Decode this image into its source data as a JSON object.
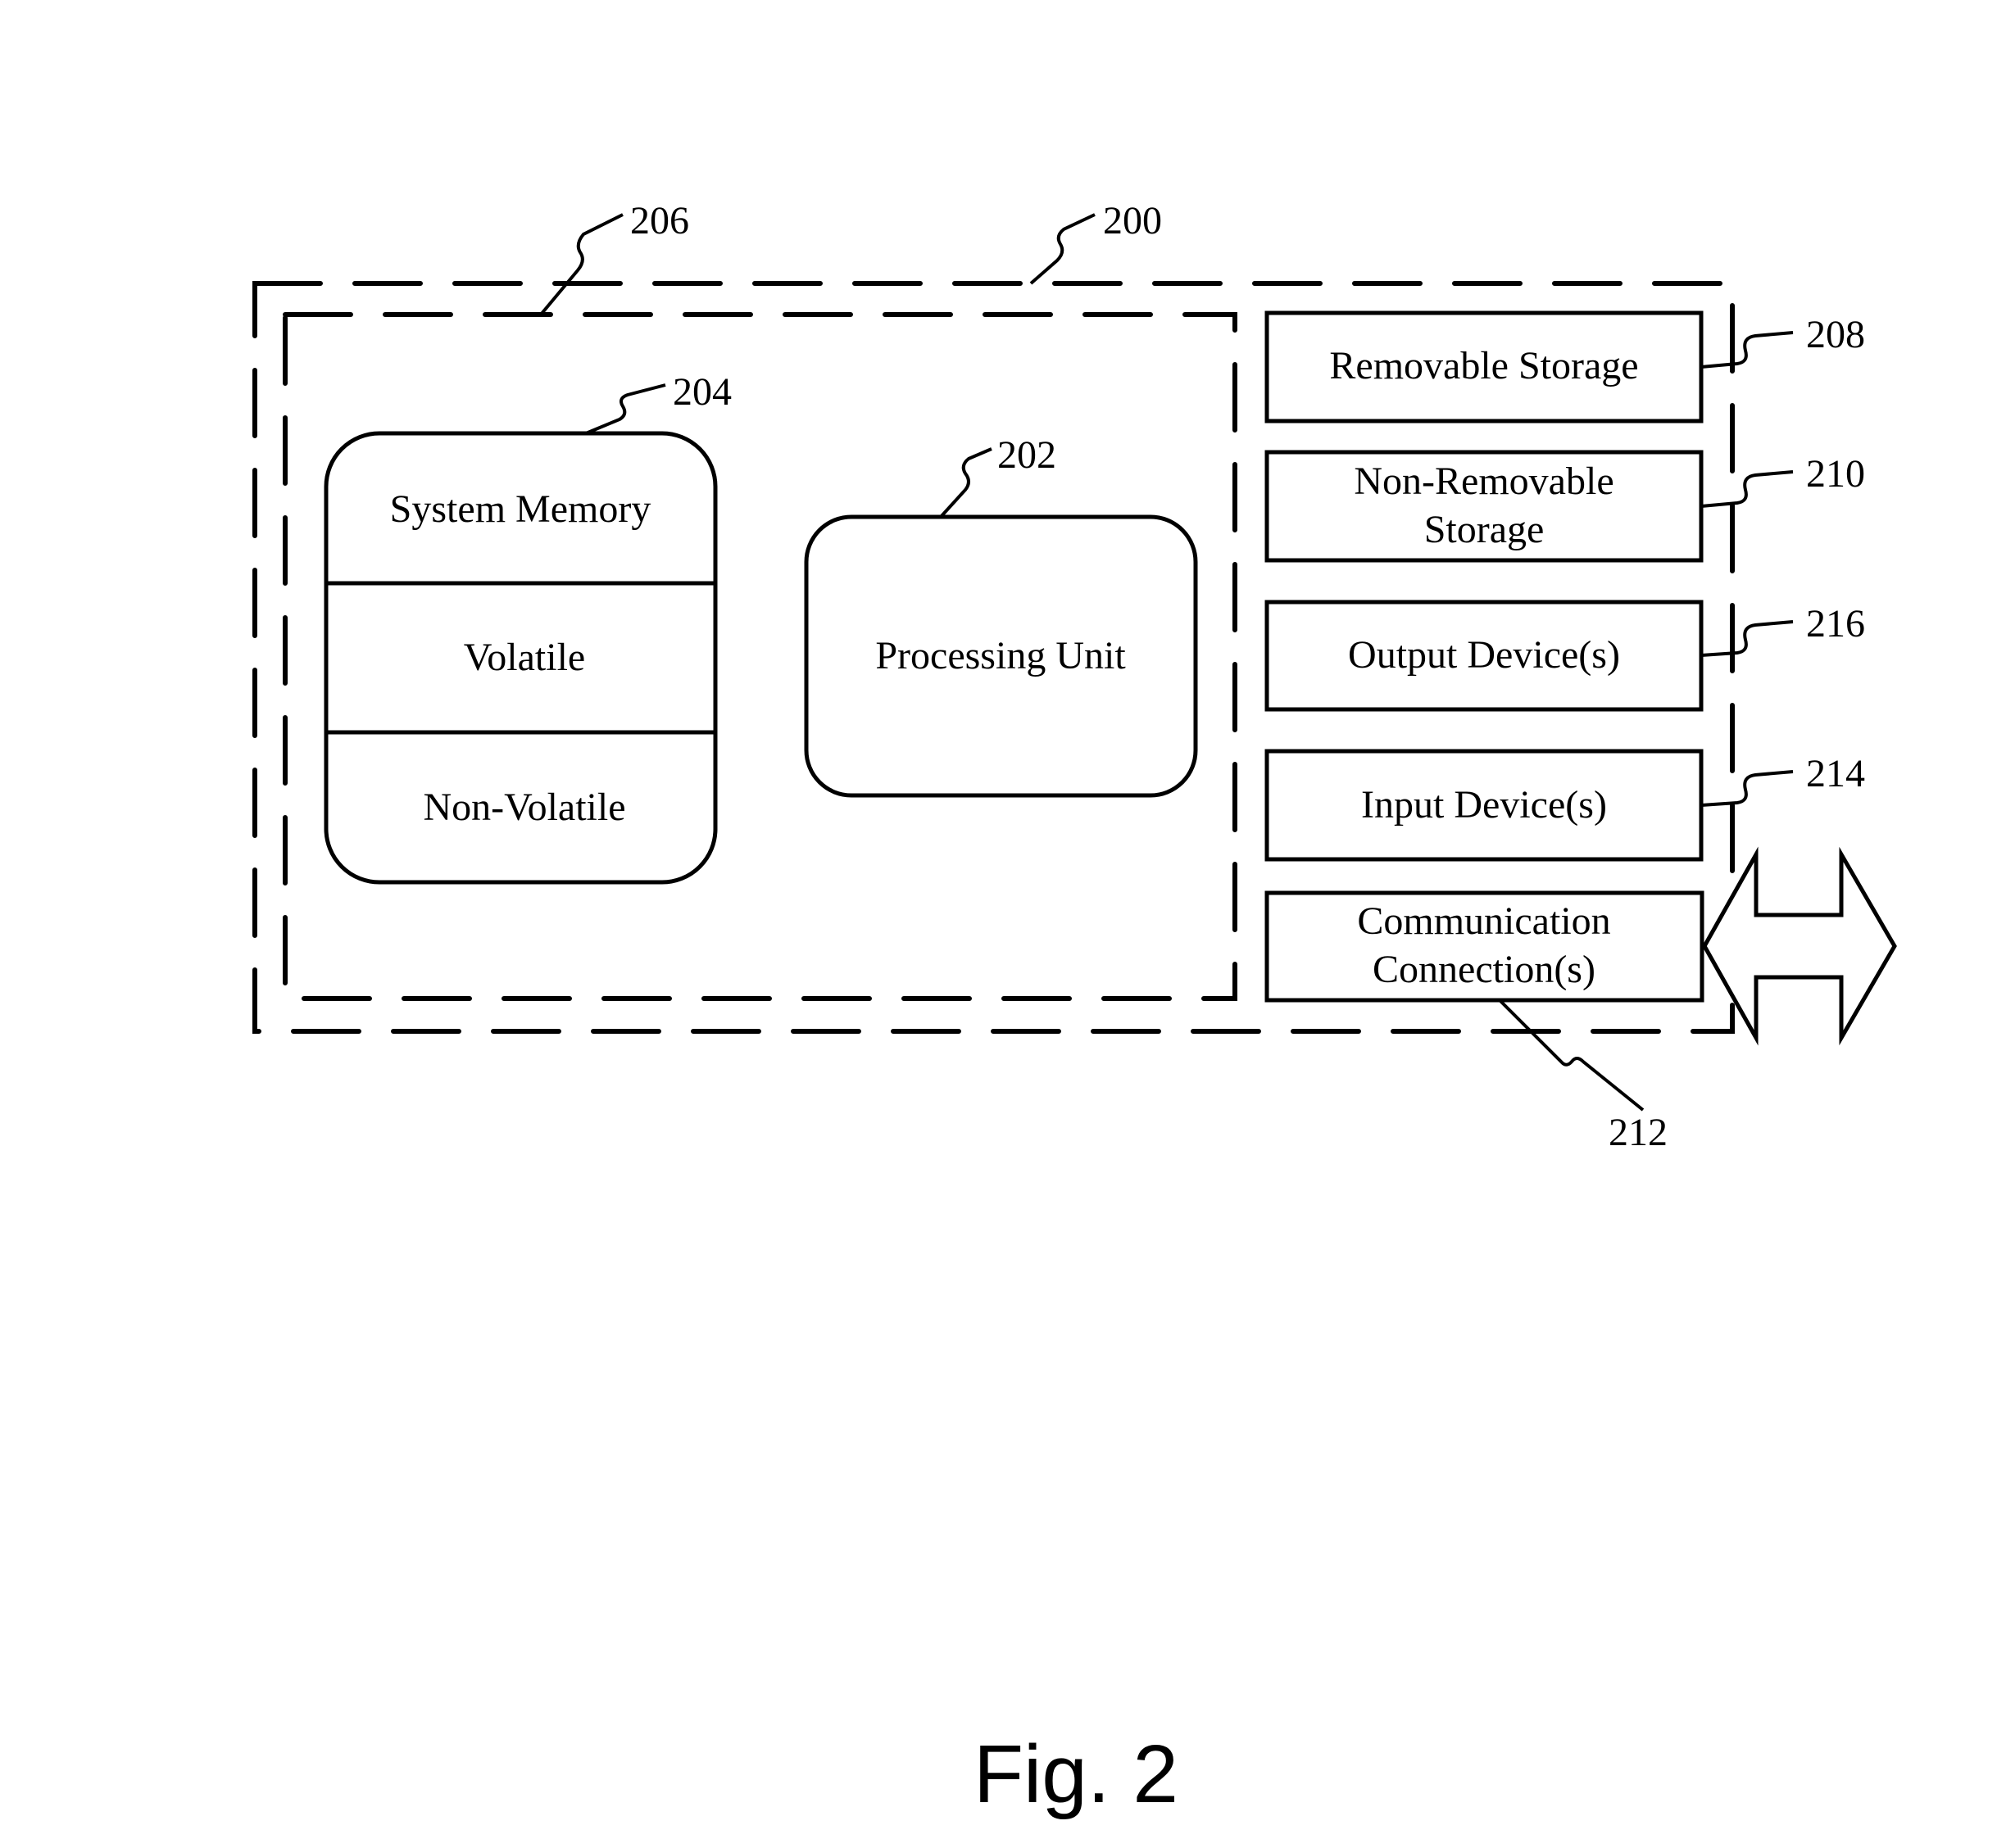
{
  "figure": {
    "caption": "Fig. 2",
    "background": "#ffffff",
    "ink": "#000000"
  },
  "device": {
    "ref": "200",
    "description": "Computing device (outer dashed boundary)"
  },
  "basic_config": {
    "ref": "206",
    "description": "Basic configuration (inner dashed boundary)"
  },
  "system_memory": {
    "ref": "204",
    "sections": [
      "System Memory",
      "Volatile",
      "Non-Volatile"
    ]
  },
  "processing_unit": {
    "ref": "202",
    "label": "Processing Unit"
  },
  "peripherals": [
    {
      "ref": "208",
      "lines": [
        "Removable Storage"
      ]
    },
    {
      "ref": "210",
      "lines": [
        "Non-Removable",
        "Storage"
      ]
    },
    {
      "ref": "216",
      "lines": [
        "Output Device(s)"
      ]
    },
    {
      "ref": "214",
      "lines": [
        "Input Device(s)"
      ]
    },
    {
      "ref": "212",
      "lines": [
        "Communication",
        "Connection(s)"
      ]
    }
  ],
  "connection_arrow": {
    "icon": "double-arrow-icon",
    "direction": "bidirectional"
  }
}
